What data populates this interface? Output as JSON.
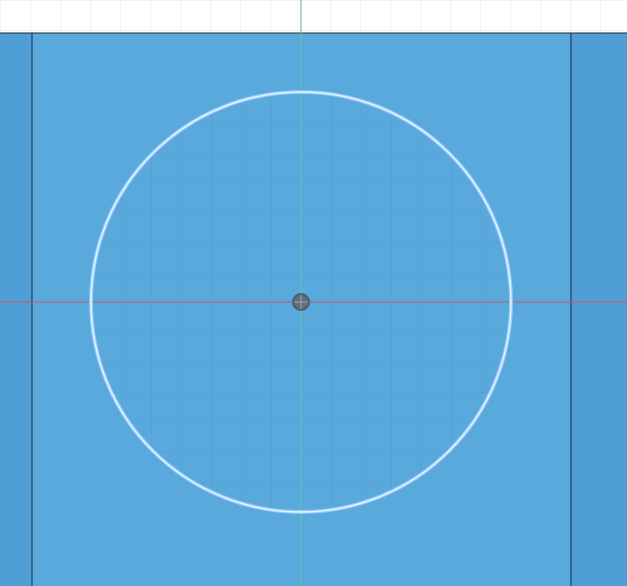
{
  "viewport": {
    "name": "sketch-canvas",
    "description_visible_text": ""
  },
  "colors": {
    "background_white": "#ffffff",
    "grid_light": "#e6e6e6",
    "sketch_plane_blue": "#5aa9dd",
    "sketch_plane_blue_dark": "#4f9fd6",
    "panel_edge": "#1f2a33",
    "axis_green": "#5cc7a0",
    "axis_red": "#c0596b",
    "circle_outline": "#e8f3ff",
    "circle_outline_inner": "#8fc9ff",
    "circle_fill": "#54a5dc",
    "origin_marker": "#4b5b66"
  },
  "sketch": {
    "entities": [
      {
        "type": "circle",
        "name": "sketch-circle"
      },
      {
        "type": "point",
        "name": "origin-point"
      }
    ]
  }
}
